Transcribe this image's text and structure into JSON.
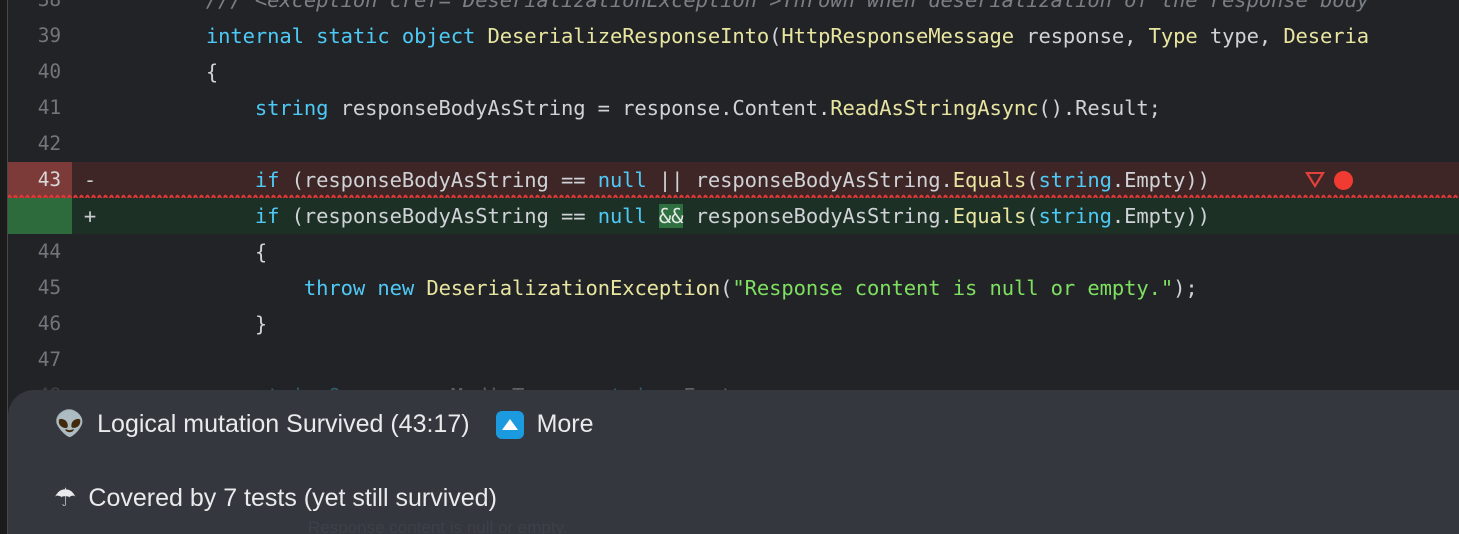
{
  "editor": {
    "language": "csharp",
    "theme_background": "#222326",
    "lines": [
      {
        "number": "38",
        "marker": "",
        "state": "clipped-top",
        "tokens": [
          {
            "cls": "cmt",
            "text": "        /// <exception cref=\"DeserializationException\">Thrown when deserialization of the response body"
          }
        ]
      },
      {
        "number": "39",
        "marker": "",
        "state": "normal",
        "tokens": [
          {
            "cls": "plain",
            "text": "        "
          },
          {
            "cls": "kw",
            "text": "internal"
          },
          {
            "cls": "plain",
            "text": " "
          },
          {
            "cls": "kw",
            "text": "static"
          },
          {
            "cls": "plain",
            "text": " "
          },
          {
            "cls": "kw",
            "text": "object"
          },
          {
            "cls": "plain",
            "text": " "
          },
          {
            "cls": "type",
            "text": "DeserializeResponseInto"
          },
          {
            "cls": "punct",
            "text": "("
          },
          {
            "cls": "type",
            "text": "HttpResponseMessage"
          },
          {
            "cls": "plain",
            "text": " response, "
          },
          {
            "cls": "type",
            "text": "Type"
          },
          {
            "cls": "plain",
            "text": " type, "
          },
          {
            "cls": "type",
            "text": "Deseria"
          }
        ]
      },
      {
        "number": "40",
        "marker": "",
        "state": "normal",
        "tokens": [
          {
            "cls": "punct",
            "text": "        {"
          }
        ]
      },
      {
        "number": "41",
        "marker": "",
        "state": "normal",
        "tokens": [
          {
            "cls": "plain",
            "text": "            "
          },
          {
            "cls": "kw",
            "text": "string"
          },
          {
            "cls": "plain",
            "text": " responseBodyAsString = response.Content."
          },
          {
            "cls": "type",
            "text": "ReadAsStringAsync"
          },
          {
            "cls": "punct",
            "text": "()"
          },
          {
            "cls": "plain",
            "text": ".Result;"
          }
        ]
      },
      {
        "number": "42",
        "marker": "",
        "state": "normal",
        "tokens": []
      },
      {
        "number": "43",
        "marker": "-",
        "state": "deleted",
        "tokens": [
          {
            "cls": "plain",
            "text": "            "
          },
          {
            "cls": "kw",
            "text": "if"
          },
          {
            "cls": "plain",
            "text": " "
          },
          {
            "cls": "punct",
            "text": "("
          },
          {
            "cls": "plain",
            "text": "responseBodyAsString == "
          },
          {
            "cls": "kw",
            "text": "null"
          },
          {
            "cls": "plain",
            "text": " "
          },
          {
            "cls": "plain",
            "text": "||"
          },
          {
            "cls": "plain",
            "text": " responseBodyAsString."
          },
          {
            "cls": "type",
            "text": "Equals"
          },
          {
            "cls": "punct",
            "text": "("
          },
          {
            "cls": "kw",
            "text": "string"
          },
          {
            "cls": "plain",
            "text": ".Empty"
          },
          {
            "cls": "punct",
            "text": "))"
          }
        ]
      },
      {
        "number": "",
        "marker": "+",
        "state": "added",
        "tokens": [
          {
            "cls": "plain",
            "text": "            "
          },
          {
            "cls": "kw",
            "text": "if"
          },
          {
            "cls": "plain",
            "text": " "
          },
          {
            "cls": "punct",
            "text": "("
          },
          {
            "cls": "plain",
            "text": "responseBodyAsString == "
          },
          {
            "cls": "kw",
            "text": "null"
          },
          {
            "cls": "plain",
            "text": " "
          },
          {
            "cls": "op-hl",
            "text": "&&"
          },
          {
            "cls": "plain",
            "text": " responseBodyAsString."
          },
          {
            "cls": "type",
            "text": "Equals"
          },
          {
            "cls": "punct",
            "text": "("
          },
          {
            "cls": "kw",
            "text": "string"
          },
          {
            "cls": "plain",
            "text": ".Empty"
          },
          {
            "cls": "punct",
            "text": "))"
          }
        ]
      },
      {
        "number": "44",
        "marker": "",
        "state": "normal",
        "tokens": [
          {
            "cls": "punct",
            "text": "            {"
          }
        ]
      },
      {
        "number": "45",
        "marker": "",
        "state": "normal",
        "tokens": [
          {
            "cls": "plain",
            "text": "                "
          },
          {
            "cls": "kw",
            "text": "throw"
          },
          {
            "cls": "plain",
            "text": " "
          },
          {
            "cls": "kw",
            "text": "new"
          },
          {
            "cls": "plain",
            "text": " "
          },
          {
            "cls": "type",
            "text": "DeserializationException"
          },
          {
            "cls": "punct",
            "text": "("
          },
          {
            "cls": "str",
            "text": "\"Response content is null or empty.\""
          },
          {
            "cls": "punct",
            "text": ")"
          },
          {
            "cls": "plain",
            "text": ";"
          }
        ]
      },
      {
        "number": "46",
        "marker": "",
        "state": "normal",
        "tokens": [
          {
            "cls": "punct",
            "text": "            }"
          }
        ]
      },
      {
        "number": "47",
        "marker": "",
        "state": "normal",
        "tokens": []
      },
      {
        "number": "48",
        "marker": "",
        "state": "faded",
        "tokens": [
          {
            "cls": "plain",
            "text": "            "
          },
          {
            "cls": "kw",
            "text": "string?"
          },
          {
            "cls": "plain",
            "text": " responseMediaType = "
          },
          {
            "cls": "kw",
            "text": "string"
          },
          {
            "cls": "plain",
            "text": ".Empty;"
          }
        ]
      }
    ],
    "deleted_line_markers": {
      "collapse_triangle": "triangle-down-red",
      "breakpoint_dot": "red-dot",
      "squiggle_color": "#e03a36"
    },
    "faded_line_marker": {
      "breakpoint_dot": "red-dot-dim"
    }
  },
  "mutation_panel": {
    "background": "#35373e",
    "row1": {
      "icon": "alien-emoji",
      "icon_glyph": "👽",
      "text": "Logical mutation Survived (43:17)",
      "more_badge_icon": "triangle-up-icon",
      "more_label": "More"
    },
    "row2": {
      "icon": "umbrella-emoji",
      "icon_glyph": "☂",
      "text": "Covered by 7 tests (yet still survived)"
    },
    "ghost_text": "Response content is null or empty."
  }
}
